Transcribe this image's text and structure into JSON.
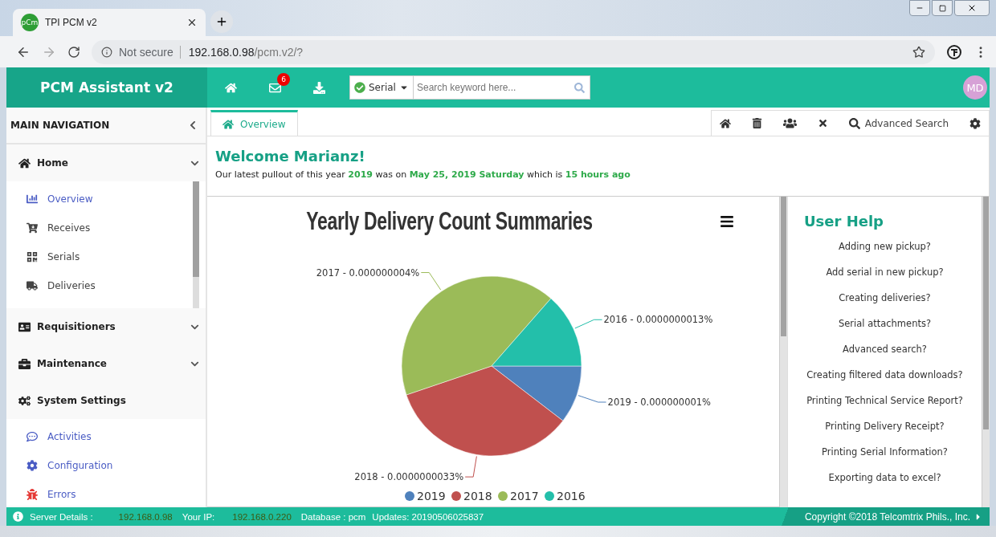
{
  "browser": {
    "tab_title": "TPI PCM v2",
    "favicon": "pCm",
    "security": "Not secure",
    "url_host": "192.168.0.98",
    "url_path": "/pcm.v2/?"
  },
  "header": {
    "brand": "PCM Assistant v2",
    "mail_badge": "6",
    "search_type": "Serial",
    "search_placeholder": "Search keyword here...",
    "avatar": "MD"
  },
  "sidebar": {
    "title": "MAIN NAVIGATION",
    "groups": [
      {
        "label": "Home",
        "caret": true,
        "children": [
          {
            "label": "Overview",
            "highlighted": true
          },
          {
            "label": "Receives",
            "highlighted": false
          },
          {
            "label": "Serials",
            "highlighted": false
          },
          {
            "label": "Deliveries",
            "highlighted": false
          }
        ]
      },
      {
        "label": "Requisitioners",
        "caret": true
      },
      {
        "label": "Maintenance",
        "caret": true
      },
      {
        "label": "System Settings",
        "caret": false,
        "children": [
          {
            "label": "Activities",
            "highlighted": true
          },
          {
            "label": "Configuration",
            "highlighted": true
          },
          {
            "label": "Errors",
            "highlighted": true
          }
        ]
      }
    ]
  },
  "tabs": [
    {
      "label": "Overview",
      "selected": true
    }
  ],
  "toolbar": {
    "advanced_search": "Advanced Search"
  },
  "welcome": {
    "title": "Welcome Marianz!",
    "message": "Our latest pullout of this year **2019** was on **May 25, 2019 Saturday** which is **15 hours ago**"
  },
  "chart": {
    "chart_data": {
      "type": "pie",
      "title": "Yearly Delivery Count Summaries",
      "categories": [
        "2019",
        "2018",
        "2017",
        "2016"
      ],
      "values": [
        10.42,
        34.38,
        41.67,
        13.53
      ],
      "legend": "bottom"
    },
    "slices": [
      {
        "label": "2019 - 0.000000001%",
        "color": "#4f81bc"
      },
      {
        "label": "2018 - 0.0000000033%",
        "color": "#c0504e"
      },
      {
        "label": "2017 - 0.000000004%",
        "color": "#9bbb58"
      },
      {
        "label": "2016 - 0.0000000013%",
        "color": "#23bfaa"
      }
    ]
  },
  "help": {
    "title": "User Help",
    "links": [
      "Adding new pickup?",
      "Add serial in new pickup?",
      "Creating deliveries?",
      "Serial attachments?",
      "Advanced search?",
      "Creating filtered data downloads?",
      "Printing Technical Service Report?",
      "Printing Delivery Receipt?",
      "Printing Serial Information?",
      "Exporting data to excel?"
    ]
  },
  "footer": {
    "server_label": "Server Details :",
    "server_ip": "192.168.0.98",
    "your_ip_label": "Your IP:",
    "your_ip": "192.168.0.220",
    "database": "Database : pcm",
    "updates": "Updates: 20190506025837",
    "copyright": "Copyright ©2018 Telcomtrix Phils., Inc."
  }
}
